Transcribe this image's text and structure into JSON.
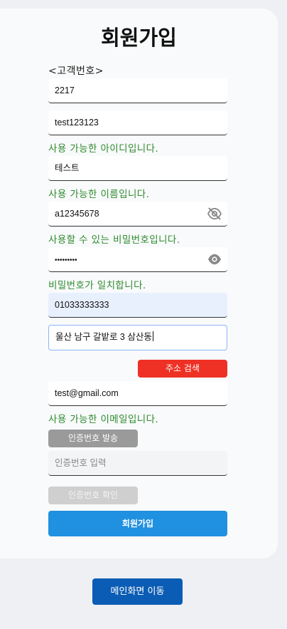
{
  "page": {
    "title": "회원가입",
    "code_label": "<고객번호>"
  },
  "form": {
    "customer_code": "2217",
    "user_id": "test123123",
    "user_id_msg": "사용 가능한 아이디입니다.",
    "name": "테스트",
    "name_msg": "사용 가능한 이름입니다.",
    "password": "a12345678",
    "password_msg": "사용할 수 있는 비밀번호입니다.",
    "password_confirm": "•••••••••",
    "password_confirm_msg": "비밀번호가 일치합니다.",
    "phone": "01033333333",
    "address": "울산 남구 갈밭로 3 삼산동",
    "address_search_label": "주소 검색",
    "email": "test@gmail.com",
    "email_msg": "사용 가능한 이메일입니다.",
    "send_code_label": "인증번호 발송",
    "code_placeholder": "인증번호 입력",
    "verify_code_label": "인증번호 확인",
    "submit_label": "회원가입"
  },
  "footer": {
    "main_label": "메인화면 이동"
  },
  "colors": {
    "success_text": "#2e8b2e",
    "search_button": "#ee3124",
    "submit_button": "#2090e0",
    "main_button": "#0b5cb4"
  },
  "icons": {
    "password_toggle": "eye-slash-icon",
    "password_confirm_toggle": "eye-icon"
  }
}
